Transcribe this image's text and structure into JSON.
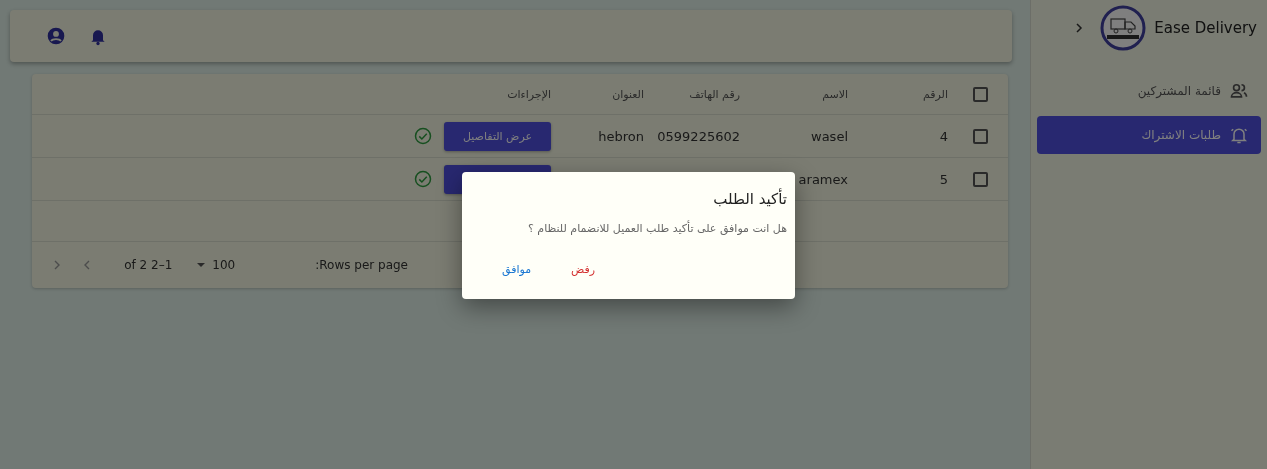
{
  "sidebar": {
    "brand": "Ease Delivery",
    "items": [
      {
        "label": "قائمة المشتركين",
        "kind": "people",
        "selected": false
      },
      {
        "label": "طلبات الاشتراك",
        "kind": "bell",
        "selected": true
      }
    ]
  },
  "table": {
    "select_all": {
      "checked": false
    },
    "columns": [
      "الرقم",
      "الاسم",
      "رقم الهاتف",
      "العنوان",
      "الإجراءات"
    ],
    "rows": [
      {
        "checked": false,
        "number": "4",
        "name": "wasel",
        "phone": "0599225602",
        "address": "hebron",
        "action": "عرض التفاصيل"
      },
      {
        "checked": false,
        "number": "5",
        "name": "aramex"
      }
    ]
  },
  "pagination": {
    "rows_per_page_label": ":Rows per page",
    "rows_per_page": "100",
    "range": "of 2 2–1"
  },
  "dialog": {
    "title": "تأكيد الطلب",
    "message": "هل انت موافق على تأكيد طلب العميل للانضمام للنظام ؟",
    "buttons": [
      {
        "label": "رفض",
        "kind": "reject"
      },
      {
        "label": "موافق",
        "kind": "confirm"
      }
    ]
  }
}
